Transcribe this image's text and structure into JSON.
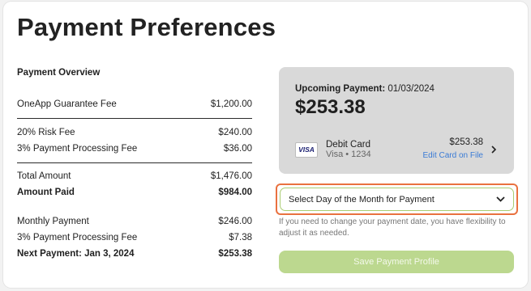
{
  "page": {
    "title": "Payment Preferences"
  },
  "overview": {
    "heading": "Payment Overview",
    "guarantee_fee": {
      "label": "OneApp Guarantee Fee",
      "value": "$1,200.00"
    },
    "risk_fee": {
      "label": "20% Risk Fee",
      "value": "$240.00"
    },
    "processing_fee": {
      "label": "3% Payment Processing Fee",
      "value": "$36.00"
    },
    "total_amount": {
      "label": "Total Amount",
      "value": "$1,476.00"
    },
    "amount_paid": {
      "label": "Amount Paid",
      "value": "$984.00"
    },
    "monthly_payment": {
      "label": "Monthly Payment",
      "value": "$246.00"
    },
    "monthly_processing_fee": {
      "label": "3% Payment Processing Fee",
      "value": "$7.38"
    },
    "next_payment": {
      "label": "Next Payment: Jan 3, 2024",
      "value": "$253.38"
    }
  },
  "summary": {
    "upcoming_label": "Upcoming Payment:",
    "upcoming_date": "01/03/2024",
    "amount": "$253.38",
    "card": {
      "brand_badge": "VISA",
      "type": "Debit Card",
      "number": "Visa • 1234",
      "amount": "$253.38",
      "edit_link": "Edit Card on File"
    }
  },
  "select": {
    "value": "Select Day of the Month for Payment"
  },
  "helper_text": "If you need to change your payment date, you have flexibility to adjust it as needed.",
  "save_button": {
    "label": "Save Payment Profile"
  },
  "colors": {
    "highlight": "#e9713f",
    "select_border": "#a9cc72",
    "button_bg": "#bcd88f",
    "link": "#3a7bd5",
    "summary_bg": "#d9d9d9"
  }
}
